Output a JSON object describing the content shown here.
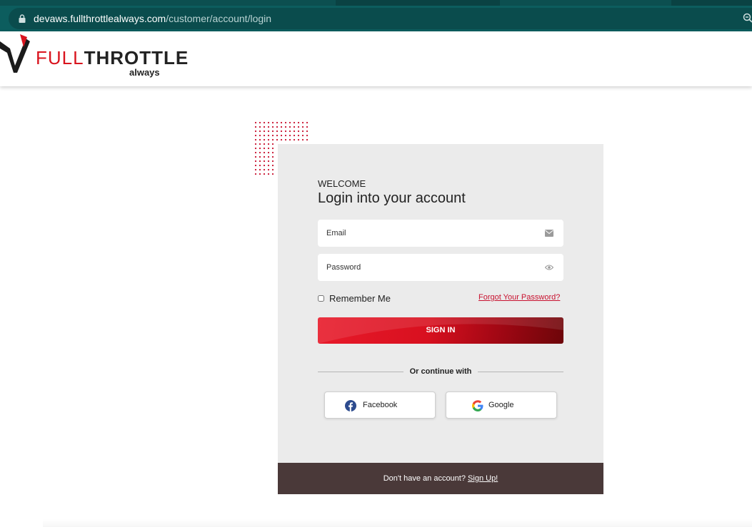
{
  "browser": {
    "url_host": "devaws.fullthrottlealways.com",
    "url_path": "/customer/account/login"
  },
  "header": {
    "logo_red": "FULL",
    "logo_dark": "THROTTLE",
    "logo_sub": "always"
  },
  "login": {
    "welcome": "WELCOME",
    "title": "Login into your account",
    "email_placeholder": "Email",
    "password_placeholder": "Password",
    "remember_label": "Remember Me",
    "forgot_label": "Forgot Your Password?",
    "signin_label": "SIGN IN",
    "divider_label": "Or continue with",
    "facebook_label": "Facebook",
    "google_label": "Google",
    "footer_prompt": "Don't have an account?",
    "signup_label": "Sign Up!"
  },
  "colors": {
    "accent": "#d9141e",
    "footer_bg": "#4a3939",
    "card_bg": "#ebebeb"
  }
}
